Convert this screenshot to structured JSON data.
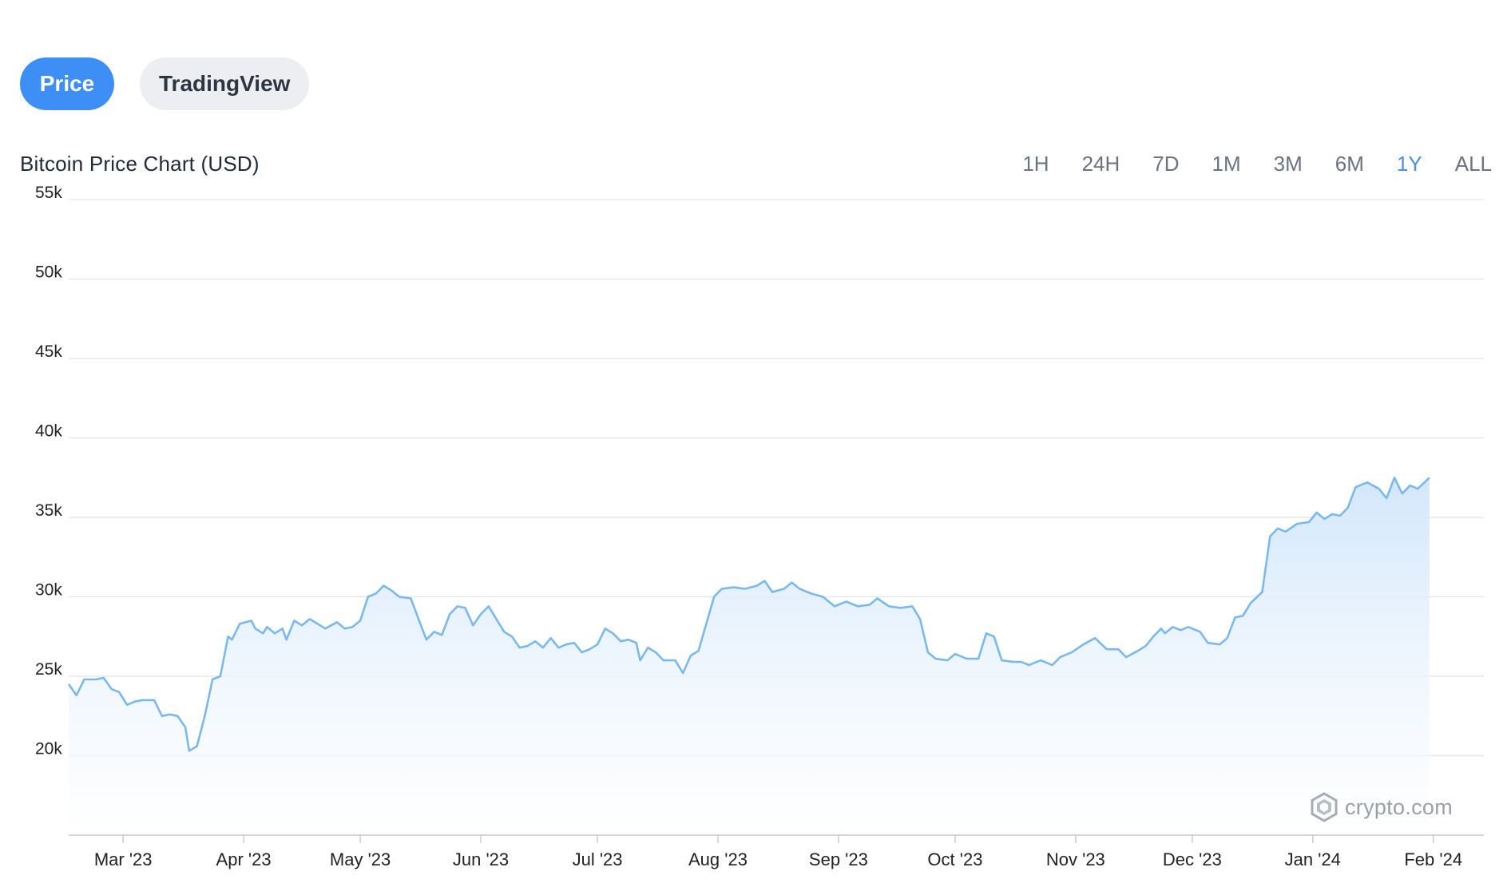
{
  "tabs": {
    "price": "Price",
    "tradingview": "TradingView"
  },
  "chart_title": "Bitcoin Price Chart (USD)",
  "ranges": [
    "1H",
    "24H",
    "7D",
    "1M",
    "3M",
    "6M",
    "1Y",
    "ALL"
  ],
  "active_range": "1Y",
  "watermark": "crypto.com",
  "colors": {
    "accent": "#3d8ef5",
    "line": "#7ab8ee",
    "area_top": "#d3e7fb",
    "grid": "#e6e8eb",
    "active_range": "#4a90e2"
  },
  "chart_data": {
    "type": "area",
    "title": "Bitcoin Price Chart (USD)",
    "ylim": [
      15000,
      55000
    ],
    "yticks": [
      20000,
      25000,
      30000,
      35000,
      40000,
      45000,
      50000,
      55000
    ],
    "ytick_labels": [
      "20k",
      "25k",
      "30k",
      "35k",
      "40k",
      "45k",
      "50k",
      "55k"
    ],
    "grid": true,
    "x_start": "2023-02-15",
    "x_end": "2024-02-14",
    "xticks": [
      "2023-03-01",
      "2023-04-01",
      "2023-05-01",
      "2023-06-01",
      "2023-07-01",
      "2023-08-01",
      "2023-09-01",
      "2023-10-01",
      "2023-11-01",
      "2023-12-01",
      "2024-01-01",
      "2024-02-01"
    ],
    "xtick_labels": [
      "Mar '23",
      "Apr '23",
      "May '23",
      "Jun '23",
      "Jul '23",
      "Aug '23",
      "Sep '23",
      "Oct '23",
      "Nov '23",
      "Dec '23",
      "Jan '24",
      "Feb '24"
    ],
    "series": [
      {
        "points": [
          [
            "2023-02-15",
            24500
          ],
          [
            "2023-02-17",
            23800
          ],
          [
            "2023-02-19",
            24800
          ],
          [
            "2023-02-22",
            24800
          ],
          [
            "2023-02-24",
            24900
          ],
          [
            "2023-02-26",
            24200
          ],
          [
            "2023-02-28",
            24000
          ],
          [
            "2023-03-02",
            23200
          ],
          [
            "2023-03-04",
            23400
          ],
          [
            "2023-03-06",
            23500
          ],
          [
            "2023-03-09",
            23500
          ],
          [
            "2023-03-11",
            22500
          ],
          [
            "2023-03-13",
            22600
          ],
          [
            "2023-03-15",
            22500
          ],
          [
            "2023-03-17",
            21800
          ],
          [
            "2023-03-18",
            20300
          ],
          [
            "2023-03-20",
            20600
          ],
          [
            "2023-03-22",
            22500
          ],
          [
            "2023-03-24",
            24800
          ],
          [
            "2023-03-26",
            25000
          ],
          [
            "2023-03-28",
            27500
          ],
          [
            "2023-03-29",
            27300
          ],
          [
            "2023-03-31",
            28300
          ],
          [
            "2023-04-03",
            28500
          ],
          [
            "2023-04-04",
            28000
          ],
          [
            "2023-04-06",
            27700
          ],
          [
            "2023-04-07",
            28100
          ],
          [
            "2023-04-09",
            27700
          ],
          [
            "2023-04-11",
            28000
          ],
          [
            "2023-04-12",
            27300
          ],
          [
            "2023-04-14",
            28500
          ],
          [
            "2023-04-16",
            28200
          ],
          [
            "2023-04-18",
            28600
          ],
          [
            "2023-04-20",
            28300
          ],
          [
            "2023-04-22",
            28000
          ],
          [
            "2023-04-25",
            28400
          ],
          [
            "2023-04-27",
            28000
          ],
          [
            "2023-04-29",
            28100
          ],
          [
            "2023-05-01",
            28500
          ],
          [
            "2023-05-03",
            30000
          ],
          [
            "2023-05-05",
            30200
          ],
          [
            "2023-05-07",
            30700
          ],
          [
            "2023-05-09",
            30400
          ],
          [
            "2023-05-11",
            30000
          ],
          [
            "2023-05-14",
            29900
          ],
          [
            "2023-05-16",
            28600
          ],
          [
            "2023-05-18",
            27300
          ],
          [
            "2023-05-20",
            27800
          ],
          [
            "2023-05-22",
            27600
          ],
          [
            "2023-05-24",
            28900
          ],
          [
            "2023-05-26",
            29400
          ],
          [
            "2023-05-28",
            29300
          ],
          [
            "2023-05-30",
            28200
          ],
          [
            "2023-06-01",
            28900
          ],
          [
            "2023-06-03",
            29400
          ],
          [
            "2023-06-05",
            28600
          ],
          [
            "2023-06-07",
            27800
          ],
          [
            "2023-06-09",
            27500
          ],
          [
            "2023-06-11",
            26800
          ],
          [
            "2023-06-13",
            26900
          ],
          [
            "2023-06-15",
            27200
          ],
          [
            "2023-06-17",
            26800
          ],
          [
            "2023-06-19",
            27400
          ],
          [
            "2023-06-21",
            26800
          ],
          [
            "2023-06-23",
            27000
          ],
          [
            "2023-06-25",
            27100
          ],
          [
            "2023-06-27",
            26500
          ],
          [
            "2023-06-29",
            26700
          ],
          [
            "2023-07-01",
            27000
          ],
          [
            "2023-07-03",
            28000
          ],
          [
            "2023-07-05",
            27700
          ],
          [
            "2023-07-07",
            27200
          ],
          [
            "2023-07-09",
            27300
          ],
          [
            "2023-07-11",
            27100
          ],
          [
            "2023-07-12",
            26000
          ],
          [
            "2023-07-14",
            26800
          ],
          [
            "2023-07-16",
            26500
          ],
          [
            "2023-07-18",
            26000
          ],
          [
            "2023-07-21",
            26000
          ],
          [
            "2023-07-23",
            25200
          ],
          [
            "2023-07-25",
            26300
          ],
          [
            "2023-07-27",
            26600
          ],
          [
            "2023-07-29",
            28300
          ],
          [
            "2023-07-31",
            30000
          ],
          [
            "2023-08-02",
            30500
          ],
          [
            "2023-08-05",
            30600
          ],
          [
            "2023-08-08",
            30500
          ],
          [
            "2023-08-11",
            30700
          ],
          [
            "2023-08-13",
            31000
          ],
          [
            "2023-08-15",
            30300
          ],
          [
            "2023-08-18",
            30500
          ],
          [
            "2023-08-20",
            30900
          ],
          [
            "2023-08-22",
            30500
          ],
          [
            "2023-08-25",
            30200
          ],
          [
            "2023-08-28",
            30000
          ],
          [
            "2023-08-31",
            29400
          ],
          [
            "2023-09-03",
            29700
          ],
          [
            "2023-09-06",
            29400
          ],
          [
            "2023-09-09",
            29500
          ],
          [
            "2023-09-11",
            29900
          ],
          [
            "2023-09-14",
            29400
          ],
          [
            "2023-09-17",
            29300
          ],
          [
            "2023-09-20",
            29400
          ],
          [
            "2023-09-22",
            28600
          ],
          [
            "2023-09-24",
            26500
          ],
          [
            "2023-09-26",
            26100
          ],
          [
            "2023-09-29",
            26000
          ],
          [
            "2023-10-01",
            26400
          ],
          [
            "2023-10-04",
            26100
          ],
          [
            "2023-10-07",
            26100
          ],
          [
            "2023-10-09",
            27700
          ],
          [
            "2023-10-11",
            27500
          ],
          [
            "2023-10-13",
            26000
          ],
          [
            "2023-10-16",
            25900
          ],
          [
            "2023-10-18",
            25900
          ],
          [
            "2023-10-20",
            25700
          ],
          [
            "2023-10-23",
            26000
          ],
          [
            "2023-10-26",
            25700
          ],
          [
            "2023-10-28",
            26200
          ],
          [
            "2023-10-31",
            26500
          ],
          [
            "2023-11-03",
            27000
          ],
          [
            "2023-11-06",
            27400
          ],
          [
            "2023-11-09",
            26700
          ],
          [
            "2023-11-12",
            26700
          ],
          [
            "2023-11-14",
            26200
          ],
          [
            "2023-11-17",
            26600
          ],
          [
            "2023-11-19",
            26900
          ],
          [
            "2023-11-21",
            27500
          ],
          [
            "2023-11-23",
            28000
          ],
          [
            "2023-11-24",
            27700
          ],
          [
            "2023-11-26",
            28100
          ],
          [
            "2023-11-28",
            27900
          ],
          [
            "2023-11-30",
            28100
          ],
          [
            "2023-12-03",
            27800
          ],
          [
            "2023-12-05",
            27100
          ],
          [
            "2023-12-08",
            27000
          ],
          [
            "2023-12-10",
            27400
          ],
          [
            "2023-12-12",
            28700
          ],
          [
            "2023-12-14",
            28800
          ],
          [
            "2023-12-16",
            29600
          ],
          [
            "2023-12-19",
            30300
          ],
          [
            "2023-12-21",
            33800
          ],
          [
            "2023-12-23",
            34300
          ],
          [
            "2023-12-25",
            34100
          ],
          [
            "2023-12-28",
            34600
          ],
          [
            "2023-12-31",
            34700
          ],
          [
            "2024-01-02",
            35300
          ],
          [
            "2024-01-04",
            34900
          ],
          [
            "2024-01-06",
            35200
          ],
          [
            "2024-01-08",
            35100
          ],
          [
            "2024-01-10",
            35600
          ],
          [
            "2024-01-12",
            36900
          ],
          [
            "2024-01-15",
            37200
          ],
          [
            "2024-01-18",
            36800
          ],
          [
            "2024-01-20",
            36200
          ],
          [
            "2024-01-22",
            37500
          ],
          [
            "2024-01-24",
            36500
          ],
          [
            "2024-01-26",
            37000
          ],
          [
            "2024-01-28",
            36800
          ],
          [
            "2024-01-31",
            37500
          ]
        ]
      }
    ]
  }
}
